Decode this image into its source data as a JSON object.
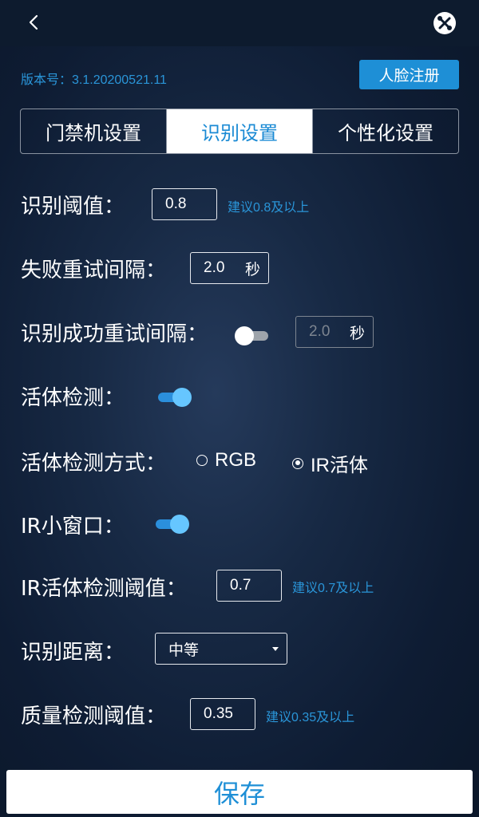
{
  "header": {
    "back_icon": "chevron-left-icon",
    "tools_icon": "tools-icon"
  },
  "version": {
    "text": "版本号：3.1.20200521.11"
  },
  "register_button": {
    "label": "人脸注册"
  },
  "tabs": [
    {
      "label": "门禁机设置",
      "active": false
    },
    {
      "label": "识别设置",
      "active": true
    },
    {
      "label": "个性化设置",
      "active": false
    }
  ],
  "settings": {
    "threshold": {
      "label": "识别阈值：",
      "value": "0.8",
      "hint": "建议0.8及以上"
    },
    "retry_interval": {
      "label": "失败重试间隔：",
      "value": "2.0",
      "unit": "秒"
    },
    "success_retry": {
      "label": "识别成功重试间隔：",
      "enabled": false,
      "value": "2.0",
      "unit": "秒"
    },
    "liveness": {
      "label": "活体检测：",
      "enabled": true
    },
    "liveness_mode": {
      "label": "活体检测方式：",
      "options": [
        {
          "label": "RGB",
          "checked": false
        },
        {
          "label": "IR活体",
          "checked": true
        }
      ]
    },
    "ir_window": {
      "label": "IR小窗口：",
      "enabled": true
    },
    "ir_threshold": {
      "label": "IR活体检测阈值：",
      "value": "0.7",
      "hint": "建议0.7及以上"
    },
    "distance": {
      "label": "识别距离：",
      "value": "中等"
    },
    "quality": {
      "label": "质量检测阈值：",
      "value": "0.35",
      "hint": "建议0.35及以上"
    }
  },
  "save_button": {
    "label": "保存"
  },
  "colors": {
    "accent": "#1e8fd6",
    "toggle_on": "#66c6ff",
    "hint": "#2a95d8"
  }
}
